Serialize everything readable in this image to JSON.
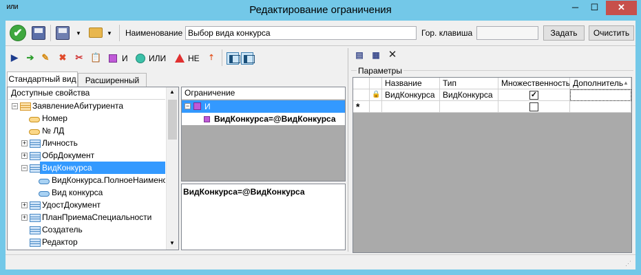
{
  "window": {
    "title": "Редактирование  ограничения",
    "app_icon_text": "ИЛИ",
    "min_glyph": "─",
    "max_glyph": "☐",
    "close_glyph": "✕"
  },
  "toolbar": {
    "ok_glyph": "✔",
    "name_label": "Наименование",
    "name_value": "Выбор вида конкурса",
    "hotkey_label": "Гор. клавиша",
    "hotkey_value": "",
    "set_button": "Задать",
    "clear_button": "Очистить"
  },
  "left_toolbar": {
    "and_label": "И",
    "or_label": "ИЛИ",
    "not_label": "НЕ"
  },
  "tabs": [
    {
      "label": "Стандартный вид",
      "active": true
    },
    {
      "label": "Расширенный вид",
      "active": false
    }
  ],
  "properties": {
    "header": "Доступные свойства",
    "items": [
      {
        "label": "ЗаявлениеАбитуриента",
        "expander": "−"
      },
      {
        "label": "Номер"
      },
      {
        "label": "№ ЛД"
      },
      {
        "label": "Личность",
        "expander": "+"
      },
      {
        "label": "ОбрДокумент",
        "expander": "+"
      },
      {
        "label": "ВидКонкурса",
        "expander": "−",
        "selected": true
      },
      {
        "label": "ВидКонкурса.ПолноеНаименова"
      },
      {
        "label": "Вид конкурса"
      },
      {
        "label": "УдостДокумент",
        "expander": "+"
      },
      {
        "label": "ПланПриемаСпециальности",
        "expander": "+"
      },
      {
        "label": "Создатель"
      },
      {
        "label": "Редактор"
      }
    ]
  },
  "constraint": {
    "header": "Ограничение",
    "root_label": "И",
    "child_label": "ВидКонкурса=@ВидКонкурса",
    "expression": "ВидКонкурса=@ВидКонкурса"
  },
  "parameters": {
    "group_label": "Параметры",
    "columns": [
      "Название",
      "Тип",
      "Множественность",
      "Дополнитель"
    ],
    "rows": [
      {
        "name": "ВидКонкурса",
        "type": "ВидКонкурса",
        "multiple": true,
        "extra": ""
      }
    ],
    "new_row_marker": "*"
  },
  "colors": {
    "titlebar": "#73c8e8",
    "selection": "#3399ff",
    "grid_background": "#aaaaaa"
  }
}
